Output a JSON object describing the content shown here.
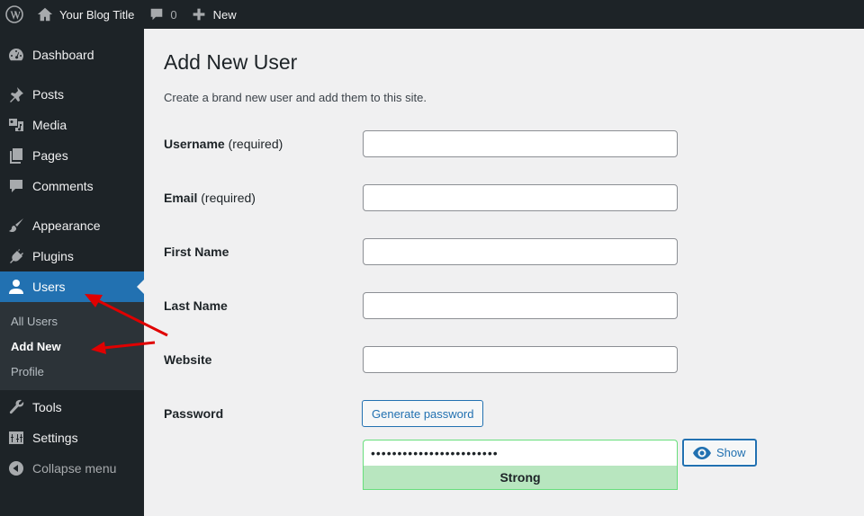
{
  "adminbar": {
    "site_title": "Your Blog Title",
    "comments_count": "0",
    "new_label": "New"
  },
  "sidebar": {
    "items": [
      {
        "label": "Dashboard",
        "icon": "dashboard-icon"
      },
      {
        "label": "Posts",
        "icon": "pin-icon"
      },
      {
        "label": "Media",
        "icon": "media-icon"
      },
      {
        "label": "Pages",
        "icon": "pages-icon"
      },
      {
        "label": "Comments",
        "icon": "comment-icon"
      },
      {
        "label": "Appearance",
        "icon": "brush-icon"
      },
      {
        "label": "Plugins",
        "icon": "plug-icon"
      },
      {
        "label": "Users",
        "icon": "user-icon",
        "active": true
      },
      {
        "label": "Tools",
        "icon": "wrench-icon"
      },
      {
        "label": "Settings",
        "icon": "settings-icon"
      }
    ],
    "users_submenu": [
      {
        "label": "All Users"
      },
      {
        "label": "Add New",
        "current": true
      },
      {
        "label": "Profile"
      }
    ],
    "collapse_label": "Collapse menu"
  },
  "main": {
    "title": "Add New User",
    "description": "Create a brand new user and add them to this site.",
    "fields": {
      "username": {
        "label": "Username",
        "note": "(required)",
        "value": ""
      },
      "email": {
        "label": "Email",
        "note": "(required)",
        "value": ""
      },
      "first_name": {
        "label": "First Name",
        "value": ""
      },
      "last_name": {
        "label": "Last Name",
        "value": ""
      },
      "website": {
        "label": "Website",
        "value": ""
      }
    },
    "password": {
      "label": "Password",
      "generate_label": "Generate password",
      "masked_value": "••••••••••••••••••••••••",
      "strength": "Strong",
      "show_label": "Show"
    }
  },
  "colors": {
    "accent": "#2271b1",
    "sidebar_bg": "#1d2327",
    "submenu_bg": "#2c3338",
    "page_bg": "#f0f0f1",
    "strength_bg": "#b8e6bf",
    "strength_border": "#68de7c",
    "annotation": "#e00000"
  }
}
